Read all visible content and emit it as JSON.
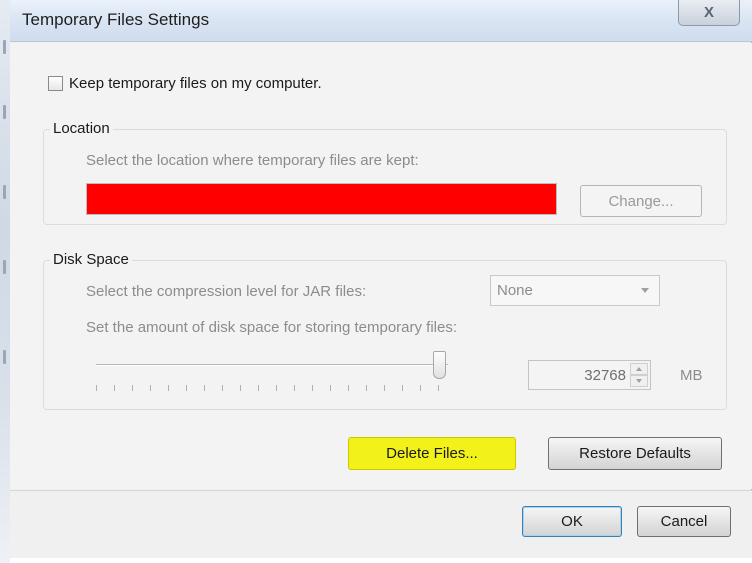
{
  "window": {
    "title": "Temporary Files Settings",
    "close_glyph": "X"
  },
  "keep_files": {
    "label": "Keep temporary files on my computer.",
    "checked": false
  },
  "location": {
    "group_title": "Location",
    "description": "Select the location where temporary files are kept:",
    "path_value": "",
    "change_label": "Change..."
  },
  "disk_space": {
    "group_title": "Disk Space",
    "compression_label": "Select the compression level for JAR files:",
    "compression_value": "None",
    "amount_label": "Set the amount of disk space for storing temporary files:",
    "size_value": "32768",
    "unit": "MB"
  },
  "actions": {
    "delete_label": "Delete Files...",
    "restore_label": "Restore Defaults"
  },
  "footer": {
    "ok_label": "OK",
    "cancel_label": "Cancel"
  },
  "colors": {
    "highlight": "#f2f21a",
    "redacted_field": "#ff0000"
  }
}
